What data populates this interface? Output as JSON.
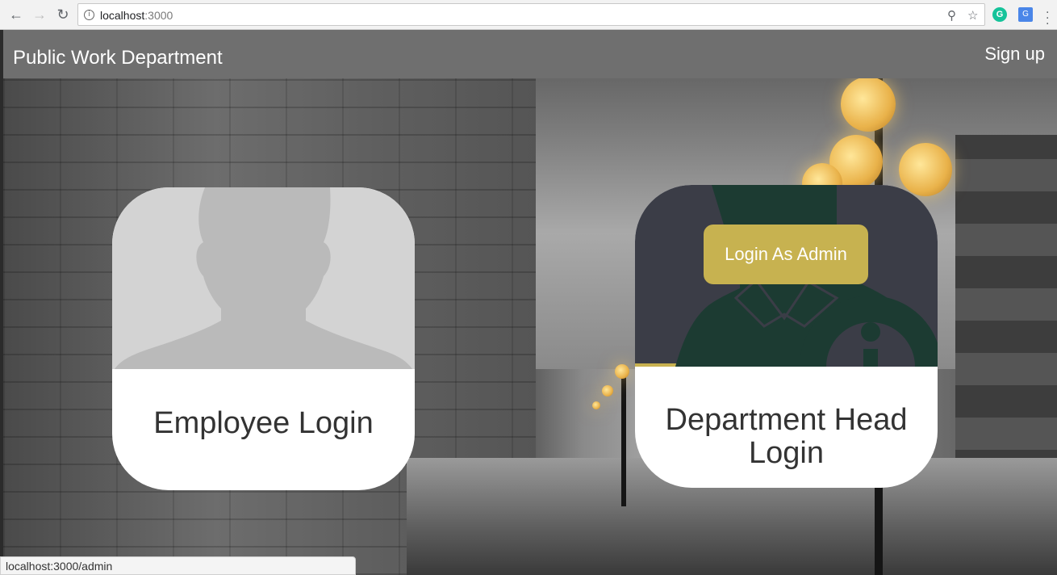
{
  "browser": {
    "url_host": "localhost",
    "url_port": ":3000",
    "status_url": "localhost:3000/admin"
  },
  "navbar": {
    "brand": "Public Work Department",
    "signup": "Sign up"
  },
  "cards": {
    "employee": {
      "label": "Employee Login"
    },
    "head": {
      "label": "Department Head Login",
      "admin_button": "Login As Admin"
    }
  },
  "colors": {
    "navbar": "#6f6f6f",
    "admin_button": "#c7b250",
    "head_photo_bg": "#3b3d47",
    "emp_photo_bg": "#d3d3d3"
  }
}
